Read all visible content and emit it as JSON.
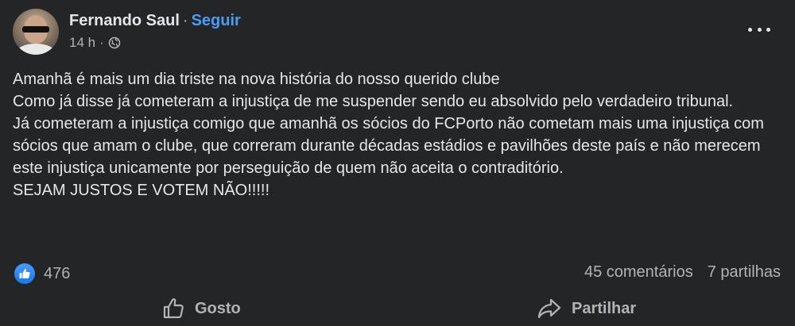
{
  "post": {
    "author": "Fernando Saul",
    "separator": "·",
    "follow_label": "Seguir",
    "time": "14 h",
    "meta_separator": "·",
    "body_lines": [
      "Amanhã é mais um dia triste na nova história do nosso querido clube",
      "Como já disse já cometeram a injustiça de me suspender sendo eu absolvido pelo verdadeiro tribunal.",
      "Já cometeram a injustiça comigo que amanhã os sócios do FCPorto não cometam mais uma injustiça com sócios que amam o clube, que correram durante décadas estádios e pavilhões deste país e não merecem este injustiça unicamente por perseguição de quem não aceita o contraditório.",
      "SEJAM JUSTOS E VOTEM NÃO!!!!!"
    ],
    "reaction_count": "476",
    "comments": "45 comentários",
    "shares": "7 partilhas",
    "like_label": "Gosto",
    "share_label": "Partilhar"
  },
  "icons": {
    "avatar": "profile-photo",
    "privacy": "globe-icon",
    "more": "more-options-icon",
    "reaction": "like-badge-icon",
    "like": "thumbs-up-icon",
    "share": "share-arrow-icon"
  },
  "colors": {
    "background": "#242526",
    "text": "#e4e6eb",
    "secondary": "#b0b3b8",
    "link": "#4b9cf5",
    "like_blue": "#1877f2"
  }
}
